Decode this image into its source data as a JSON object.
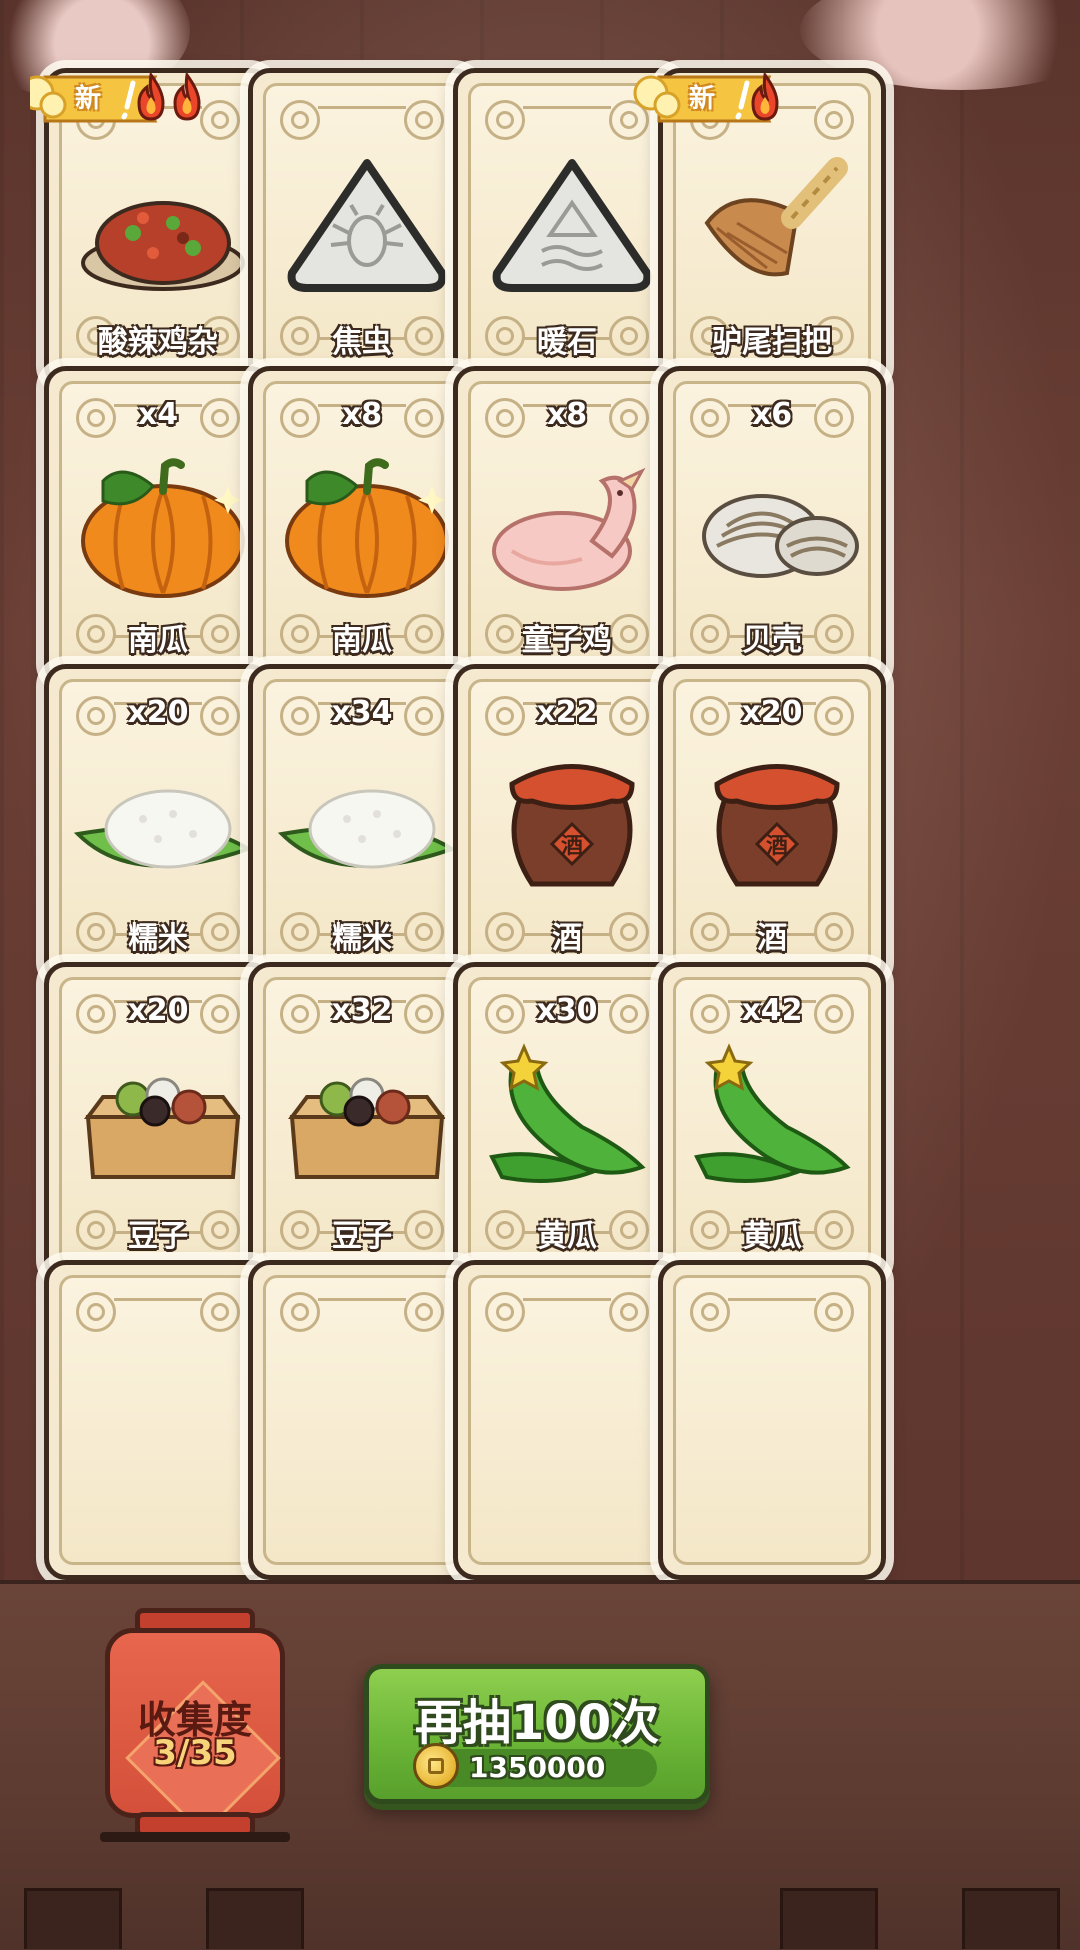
{
  "cards": [
    {
      "name": "酸辣鸡杂",
      "count": "",
      "is_new": true,
      "flames": 2,
      "icon": "spicy-chicken-giblets-icon"
    },
    {
      "name": "焦虫",
      "count": "",
      "is_new": false,
      "flames": 0,
      "icon": "beetle-stone-icon"
    },
    {
      "name": "暖石",
      "count": "",
      "is_new": false,
      "flames": 0,
      "icon": "warm-stone-icon"
    },
    {
      "name": "驴尾扫把",
      "count": "",
      "is_new": true,
      "flames": 1,
      "icon": "broom-icon"
    },
    {
      "name": "南瓜",
      "count": "x4",
      "is_new": false,
      "flames": 0,
      "icon": "pumpkin-icon"
    },
    {
      "name": "南瓜",
      "count": "x8",
      "is_new": false,
      "flames": 0,
      "icon": "pumpkin-icon"
    },
    {
      "name": "童子鸡",
      "count": "x8",
      "is_new": false,
      "flames": 0,
      "icon": "chicken-icon"
    },
    {
      "name": "贝壳",
      "count": "x6",
      "is_new": false,
      "flames": 0,
      "icon": "shell-icon"
    },
    {
      "name": "糯米",
      "count": "x20",
      "is_new": false,
      "flames": 0,
      "icon": "sticky-rice-icon"
    },
    {
      "name": "糯米",
      "count": "x34",
      "is_new": false,
      "flames": 0,
      "icon": "sticky-rice-icon"
    },
    {
      "name": "酒",
      "count": "x22",
      "is_new": false,
      "flames": 0,
      "icon": "wine-jar-icon",
      "jar_label": "酒"
    },
    {
      "name": "酒",
      "count": "x20",
      "is_new": false,
      "flames": 0,
      "icon": "wine-jar-icon",
      "jar_label": "酒"
    },
    {
      "name": "豆子",
      "count": "x20",
      "is_new": false,
      "flames": 0,
      "icon": "beans-box-icon"
    },
    {
      "name": "豆子",
      "count": "x32",
      "is_new": false,
      "flames": 0,
      "icon": "beans-box-icon"
    },
    {
      "name": "黄瓜",
      "count": "x30",
      "is_new": false,
      "flames": 0,
      "icon": "cucumber-icon"
    },
    {
      "name": "黄瓜",
      "count": "x42",
      "is_new": false,
      "flames": 0,
      "icon": "cucumber-icon"
    }
  ],
  "new_badge_label": "新",
  "collection": {
    "title": "收集度",
    "progress": "3/35"
  },
  "draw_button": {
    "label": "再抽100次",
    "cost": "1350000",
    "cost_icon": "coin-icon"
  },
  "colors": {
    "button_green": "#6bb537",
    "lantern_red": "#d4503a",
    "card_bg": "#f5ead0",
    "card_border": "#3d2a1e"
  }
}
